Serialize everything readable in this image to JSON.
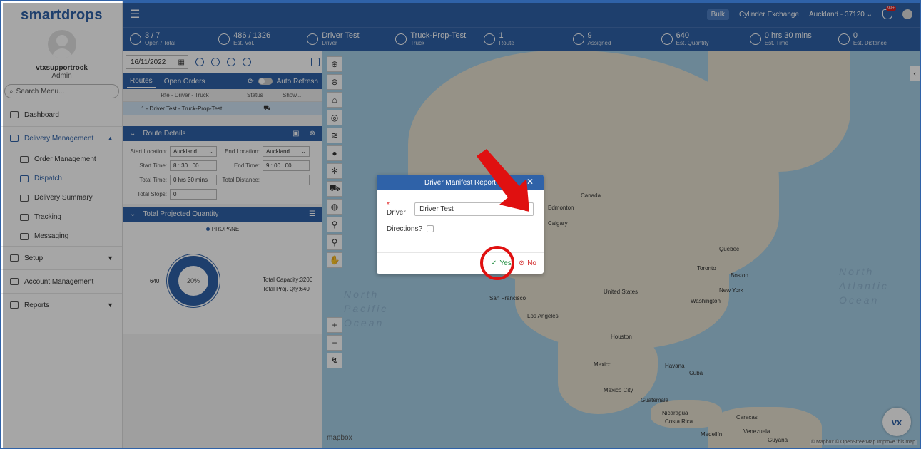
{
  "app": {
    "logo": "smartdrops",
    "user": "vtxsupportrock",
    "role": "Admin",
    "search_placeholder": "Search Menu..."
  },
  "nav": [
    {
      "label": "Dashboard",
      "icon": "dashboard-icon"
    },
    {
      "label": "Delivery Management",
      "icon": "truck-icon"
    },
    {
      "label": "Order Management",
      "icon": "order-icon"
    },
    {
      "label": "Dispatch",
      "icon": "dispatch-icon"
    },
    {
      "label": "Delivery Summary",
      "icon": "summary-icon"
    },
    {
      "label": "Tracking",
      "icon": "tracking-icon"
    },
    {
      "label": "Messaging",
      "icon": "message-icon"
    },
    {
      "label": "Setup",
      "icon": "setup-icon"
    },
    {
      "label": "Account Management",
      "icon": "account-icon"
    },
    {
      "label": "Reports",
      "icon": "reports-icon"
    }
  ],
  "topbar": {
    "bulk": "Bulk",
    "cylinder": "Cylinder Exchange",
    "location": "Auckland - 37120",
    "bell_badge": "99+"
  },
  "stats": [
    {
      "value": "3 / 7",
      "label": "Open / Total"
    },
    {
      "value": "486 / 1326",
      "label": "Est. Vol."
    },
    {
      "value": "Driver Test",
      "label": "Driver"
    },
    {
      "value": "Truck-Prop-Test",
      "label": "Truck"
    },
    {
      "value": "1",
      "label": "Route"
    },
    {
      "value": "9",
      "label": "Assigned"
    },
    {
      "value": "640",
      "label": "Est. Quantity"
    },
    {
      "value": "0 hrs 30 mins",
      "label": "Est. Time"
    },
    {
      "value": "0",
      "label": "Est. Distance"
    }
  ],
  "panel": {
    "date": "16/11/2022",
    "tab_routes": "Routes",
    "tab_open": "Open Orders",
    "auto_refresh": "Auto Refresh",
    "col_rte": "Rte - Driver - Truck",
    "col_status": "Status",
    "col_show": "Show...",
    "row1": "1 - Driver Test - Truck-Prop-Test",
    "route_details": "Route Details",
    "start_loc_label": "Start Location:",
    "start_loc": "Auckland",
    "end_loc_label": "End Location:",
    "end_loc": "Auckland",
    "start_time_label": "Start Time:",
    "start_time": "8 : 30 : 00",
    "end_time_label": "End Time:",
    "end_time": "9 : 00 : 00",
    "total_time_label": "Total Time:",
    "total_time": "0 hrs 30 mins",
    "total_dist_label": "Total Distance:",
    "total_stops_label": "Total Stops:",
    "total_stops": "0",
    "qty_title": "Total Projected Quantity",
    "legend": "PROPANE",
    "donut_pct": "20%",
    "donut_val": "640",
    "total_capacity": "Total Capacity:3200",
    "total_proj": "Total Proj. Qty:640"
  },
  "map": {
    "labels": [
      "Canada",
      "Edmonton",
      "Calgary",
      "Quebec",
      "Toronto",
      "Boston",
      "New York",
      "Washington",
      "United States",
      "San Francisco",
      "Los Angeles",
      "Houston",
      "Mexico",
      "Mexico City",
      "Havana",
      "Cuba",
      "Guatemala",
      "Nicaragua",
      "Costa Rica",
      "Caracas",
      "Venezuela",
      "Medellín",
      "Guyana"
    ],
    "north_pacific": "North Pacific Ocean",
    "north_atlantic": "North Atlantic Ocean",
    "mapbox": "mapbox",
    "attribution": "© Mapbox © OpenStreetMap Improve this map"
  },
  "modal": {
    "title": "Driver Manifest Report",
    "driver_label": "Driver",
    "driver_value": "Driver Test",
    "directions_label": "Directions?",
    "yes": "Yes",
    "no": "No"
  }
}
